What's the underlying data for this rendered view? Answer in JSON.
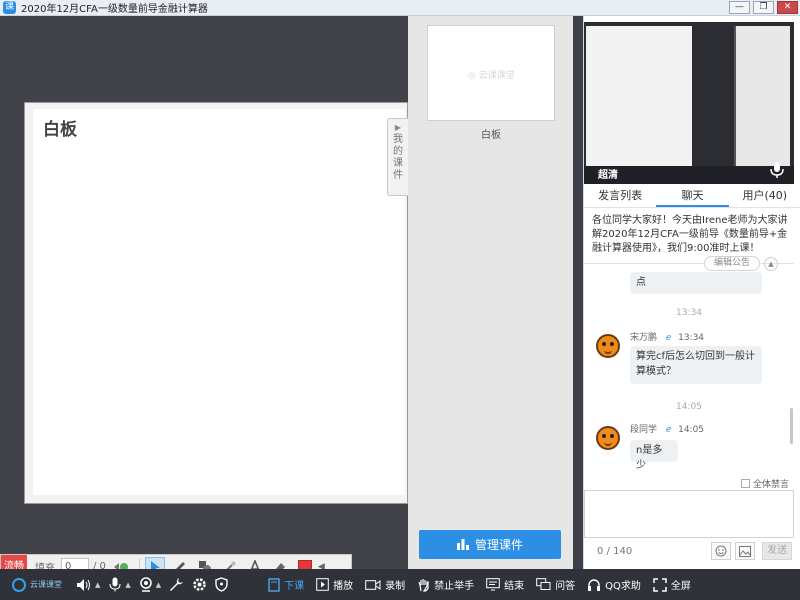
{
  "window": {
    "title": "2020年12月CFA一级数量前导金融计算器",
    "app_icon": "课",
    "minimize": "—",
    "restore": "❐",
    "close": "✕"
  },
  "whiteboard": {
    "title": "白板",
    "side_tab": "我的课件"
  },
  "draw_toolbar": {
    "stop_label": "流畅",
    "fill_label": "填充",
    "page_input": "0",
    "page_total": "/ 0",
    "active_color": "#e23a3a"
  },
  "courseware": {
    "thumb_label": "白板",
    "thumb_logo": "◎ 云课课堂",
    "manage_label": "管理课件"
  },
  "video": {
    "quality": "超清"
  },
  "tabs": [
    {
      "label": "发言列表"
    },
    {
      "label": "聊天"
    },
    {
      "label": "用户(40)"
    }
  ],
  "notice": {
    "text": "各位同学大家好！今天由Irene老师为大家讲解2020年12月CFA一级前导《数量前导+金融计算器使用》，我们9:00准时上课！",
    "edit_label": "编辑公告"
  },
  "chat": {
    "messages": [
      {
        "text": "点"
      },
      {
        "time": "13:34",
        "sender": "宋万鹏",
        "sender_time": "13:34",
        "text": "算完cf后怎么切回到一般计算模式？"
      },
      {
        "time": "14:05",
        "sender": "段同学",
        "sender_time": "14:05",
        "text": "n是多少"
      }
    ],
    "mute_all_label": "全体禁言",
    "count": "0 / 140",
    "send_label": "发送"
  },
  "bottombar": {
    "brand": "云课课堂",
    "actions": [
      {
        "label": "下课"
      },
      {
        "label": "播放"
      },
      {
        "label": "录制"
      },
      {
        "label": "禁止举手"
      },
      {
        "label": "结束"
      },
      {
        "label": "问答"
      },
      {
        "label": "QQ求助"
      },
      {
        "label": "全屏"
      }
    ],
    "accent_color": "#4aa7f0"
  }
}
